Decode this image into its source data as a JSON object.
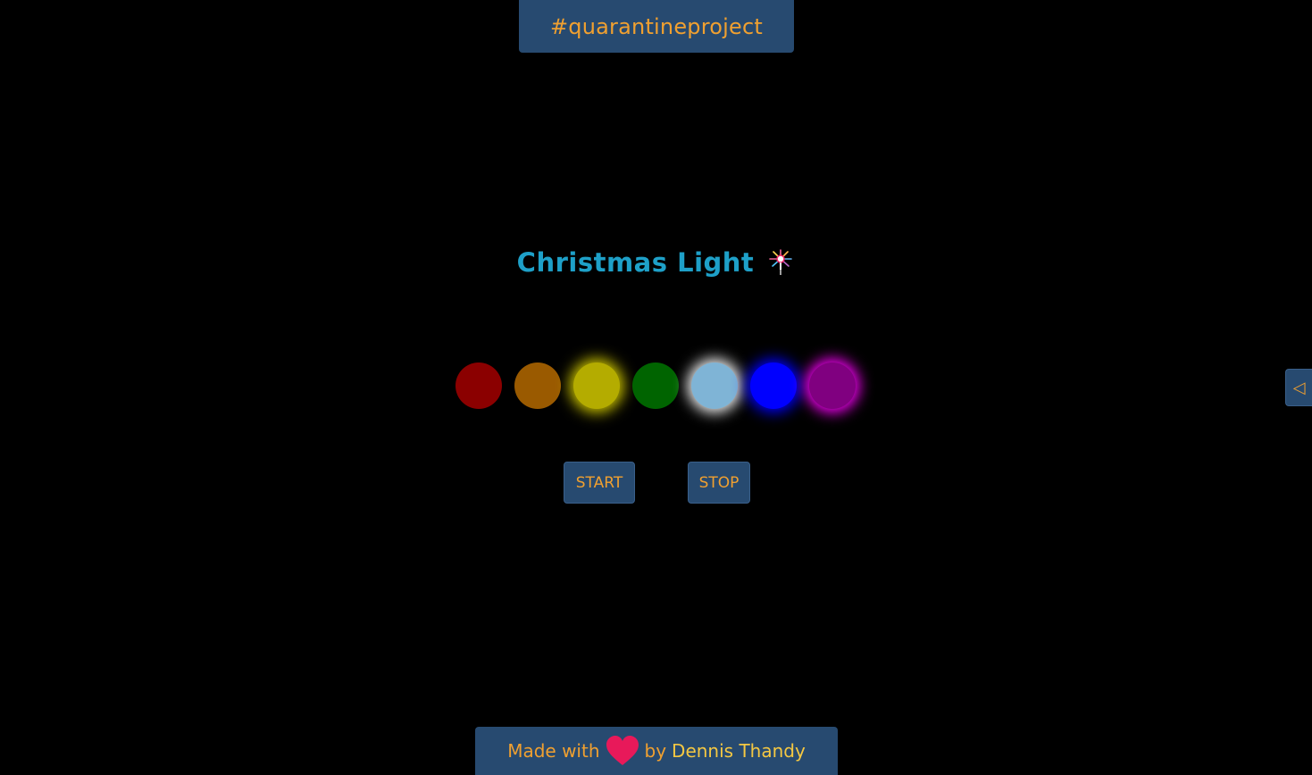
{
  "header": {
    "hashtag": "#quarantineproject"
  },
  "main": {
    "title": "Christmas Light",
    "title_icon": "sparkler-icon",
    "lights": [
      {
        "name": "red",
        "color": "#8b0000",
        "glow": "none"
      },
      {
        "name": "orange",
        "color": "#9a5a00",
        "glow": "none"
      },
      {
        "name": "yellow",
        "color": "#b4ac00",
        "glow": "#d4cc00"
      },
      {
        "name": "green",
        "color": "#006400",
        "glow": "none"
      },
      {
        "name": "light-blue",
        "color": "#7fb4d6",
        "glow": "#ffffff"
      },
      {
        "name": "blue",
        "color": "#0000ff",
        "glow": "#0000ff"
      },
      {
        "name": "purple",
        "color": "#800080",
        "glow": "#ff00ff"
      }
    ],
    "start_label": "START",
    "stop_label": "STOP"
  },
  "side_toggle": {
    "icon": "triangle-left-icon",
    "glyph": "◁"
  },
  "footer": {
    "made_with": "Made with",
    "heart_icon": "heart-icon",
    "by": "by",
    "author": "Dennis Thandy"
  },
  "colors": {
    "background": "#000000",
    "panel": "#274a70",
    "accent_text": "#f0a030",
    "title": "#1ea0c8",
    "heart": "#e8195a",
    "author": "#f5c842"
  }
}
